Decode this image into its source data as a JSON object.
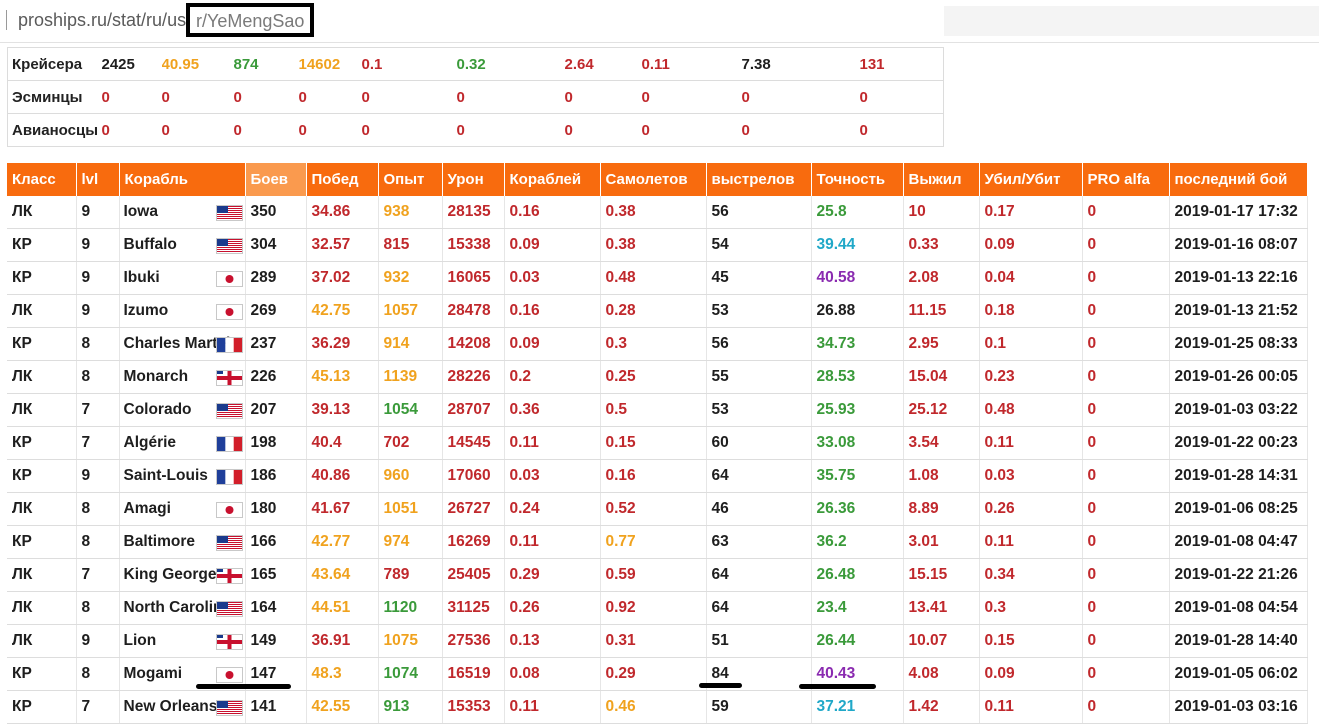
{
  "url": {
    "prefix": "proships.ru/stat/ru/us",
    "boxed": "r/YeMengSao"
  },
  "colors": {
    "header_bg": "#f86b0e",
    "header_sorted_bg": "#fa9a4e",
    "black": "#1e1e1e",
    "red": "#c0282c",
    "orange": "#f0a21e",
    "green": "#3a9a3a",
    "teal": "#20a8c8",
    "purple": "#8a2ab0"
  },
  "summary": {
    "rows": [
      {
        "label": "Крейсера",
        "cells": [
          {
            "v": "2425",
            "c": "black"
          },
          {
            "v": "40.95",
            "c": "orange"
          },
          {
            "v": "874",
            "c": "green"
          },
          {
            "v": "14602",
            "c": "orange"
          },
          {
            "v": "0.1",
            "c": "red"
          },
          {
            "v": "0.32",
            "c": "green"
          },
          {
            "v": "2.64",
            "c": "red"
          },
          {
            "v": "0.11",
            "c": "red"
          },
          {
            "v": "7.38",
            "c": "black"
          },
          {
            "v": "131",
            "c": "red"
          }
        ]
      },
      {
        "label": "Эсминцы",
        "cells": [
          {
            "v": "0",
            "c": "red"
          },
          {
            "v": "0",
            "c": "red"
          },
          {
            "v": "0",
            "c": "red"
          },
          {
            "v": "0",
            "c": "red"
          },
          {
            "v": "0",
            "c": "red"
          },
          {
            "v": "0",
            "c": "red"
          },
          {
            "v": "0",
            "c": "red"
          },
          {
            "v": "0",
            "c": "red"
          },
          {
            "v": "0",
            "c": "red"
          },
          {
            "v": "0",
            "c": "red"
          }
        ]
      },
      {
        "label": "Авианосцы",
        "cells": [
          {
            "v": "0",
            "c": "red"
          },
          {
            "v": "0",
            "c": "red"
          },
          {
            "v": "0",
            "c": "red"
          },
          {
            "v": "0",
            "c": "red"
          },
          {
            "v": "0",
            "c": "red"
          },
          {
            "v": "0",
            "c": "red"
          },
          {
            "v": "0",
            "c": "red"
          },
          {
            "v": "0",
            "c": "red"
          },
          {
            "v": "0",
            "c": "red"
          },
          {
            "v": "0",
            "c": "red"
          }
        ]
      }
    ]
  },
  "table": {
    "headers": [
      "Класс",
      "lvl",
      "Корабль",
      "Боев",
      "Побед",
      "Опыт",
      "Урон",
      "Кораблей",
      "Самолетов",
      "выстрелов",
      "Точность",
      "Выжил",
      "Убил/Убит",
      "PRO alfa",
      "последний бой"
    ],
    "sorted_column": "Боев",
    "rows": [
      {
        "cls": "ЛК",
        "lvl": "9",
        "ship": "Iowa",
        "flag": "us",
        "battles": "350",
        "wins": "34.86",
        "wins_c": "red",
        "xp": "938",
        "xp_c": "orange",
        "dmg": "28135",
        "kills": "0.16",
        "planes": "0.38",
        "planes_c": "red",
        "shots": "56",
        "acc": "25.8",
        "acc_c": "green",
        "surv": "10",
        "kd": "0.17",
        "pro": "0",
        "last": "2019-01-17 17:32"
      },
      {
        "cls": "КР",
        "lvl": "9",
        "ship": "Buffalo",
        "flag": "us",
        "battles": "304",
        "wins": "32.57",
        "wins_c": "red",
        "xp": "815",
        "xp_c": "red",
        "dmg": "15338",
        "kills": "0.09",
        "planes": "0.38",
        "planes_c": "red",
        "shots": "54",
        "acc": "39.44",
        "acc_c": "teal",
        "surv": "0.33",
        "kd": "0.09",
        "pro": "0",
        "last": "2019-01-16 08:07"
      },
      {
        "cls": "КР",
        "lvl": "9",
        "ship": "Ibuki",
        "flag": "jp",
        "battles": "289",
        "wins": "37.02",
        "wins_c": "red",
        "xp": "932",
        "xp_c": "orange",
        "dmg": "16065",
        "kills": "0.03",
        "planes": "0.48",
        "planes_c": "red",
        "shots": "45",
        "acc": "40.58",
        "acc_c": "purple",
        "surv": "2.08",
        "kd": "0.04",
        "pro": "0",
        "last": "2019-01-13 22:16"
      },
      {
        "cls": "ЛК",
        "lvl": "9",
        "ship": "Izumo",
        "flag": "jp",
        "battles": "269",
        "wins": "42.75",
        "wins_c": "orange",
        "xp": "1057",
        "xp_c": "orange",
        "dmg": "28478",
        "kills": "0.16",
        "planes": "0.28",
        "planes_c": "red",
        "shots": "53",
        "acc": "26.88",
        "acc_c": "black",
        "surv": "11.15",
        "kd": "0.18",
        "pro": "0",
        "last": "2019-01-13 21:52"
      },
      {
        "cls": "КР",
        "lvl": "8",
        "ship": "Charles Martel",
        "flag": "fr",
        "battles": "237",
        "wins": "36.29",
        "wins_c": "red",
        "xp": "914",
        "xp_c": "orange",
        "dmg": "14208",
        "kills": "0.09",
        "planes": "0.3",
        "planes_c": "red",
        "shots": "56",
        "acc": "34.73",
        "acc_c": "green",
        "surv": "2.95",
        "kd": "0.1",
        "pro": "0",
        "last": "2019-01-25 08:33"
      },
      {
        "cls": "ЛК",
        "lvl": "8",
        "ship": "Monarch",
        "flag": "uk",
        "battles": "226",
        "wins": "45.13",
        "wins_c": "orange",
        "xp": "1139",
        "xp_c": "orange",
        "dmg": "28226",
        "kills": "0.2",
        "planes": "0.25",
        "planes_c": "red",
        "shots": "55",
        "acc": "28.53",
        "acc_c": "green",
        "surv": "15.04",
        "kd": "0.23",
        "pro": "0",
        "last": "2019-01-26 00:05"
      },
      {
        "cls": "ЛК",
        "lvl": "7",
        "ship": "Colorado",
        "flag": "us",
        "battles": "207",
        "wins": "39.13",
        "wins_c": "red",
        "xp": "1054",
        "xp_c": "green",
        "dmg": "28707",
        "kills": "0.36",
        "planes": "0.5",
        "planes_c": "red",
        "shots": "53",
        "acc": "25.93",
        "acc_c": "green",
        "surv": "25.12",
        "kd": "0.48",
        "pro": "0",
        "last": "2019-01-03 03:22"
      },
      {
        "cls": "КР",
        "lvl": "7",
        "ship": "Algérie",
        "flag": "fr",
        "battles": "198",
        "wins": "40.4",
        "wins_c": "red",
        "xp": "702",
        "xp_c": "red",
        "dmg": "14545",
        "kills": "0.11",
        "planes": "0.15",
        "planes_c": "red",
        "shots": "60",
        "acc": "33.08",
        "acc_c": "green",
        "surv": "3.54",
        "kd": "0.11",
        "pro": "0",
        "last": "2019-01-22 00:23"
      },
      {
        "cls": "КР",
        "lvl": "9",
        "ship": "Saint-Louis",
        "flag": "fr",
        "battles": "186",
        "wins": "40.86",
        "wins_c": "red",
        "xp": "960",
        "xp_c": "orange",
        "dmg": "17060",
        "kills": "0.03",
        "planes": "0.16",
        "planes_c": "red",
        "shots": "64",
        "acc": "35.75",
        "acc_c": "green",
        "surv": "1.08",
        "kd": "0.03",
        "pro": "0",
        "last": "2019-01-28 14:31"
      },
      {
        "cls": "ЛК",
        "lvl": "8",
        "ship": "Amagi",
        "flag": "jp",
        "battles": "180",
        "wins": "41.67",
        "wins_c": "red",
        "xp": "1051",
        "xp_c": "orange",
        "dmg": "26727",
        "kills": "0.24",
        "planes": "0.52",
        "planes_c": "red",
        "shots": "46",
        "acc": "26.36",
        "acc_c": "green",
        "surv": "8.89",
        "kd": "0.26",
        "pro": "0",
        "last": "2019-01-06 08:25"
      },
      {
        "cls": "КР",
        "lvl": "8",
        "ship": "Baltimore",
        "flag": "us",
        "battles": "166",
        "wins": "42.77",
        "wins_c": "orange",
        "xp": "974",
        "xp_c": "orange",
        "dmg": "16269",
        "kills": "0.11",
        "planes": "0.77",
        "planes_c": "orange",
        "shots": "63",
        "acc": "36.2",
        "acc_c": "green",
        "surv": "3.01",
        "kd": "0.11",
        "pro": "0",
        "last": "2019-01-08 04:47"
      },
      {
        "cls": "ЛК",
        "lvl": "7",
        "ship": "King George V",
        "flag": "uk",
        "battles": "165",
        "wins": "43.64",
        "wins_c": "orange",
        "xp": "789",
        "xp_c": "red",
        "dmg": "25405",
        "kills": "0.29",
        "planes": "0.59",
        "planes_c": "red",
        "shots": "64",
        "acc": "26.48",
        "acc_c": "green",
        "surv": "15.15",
        "kd": "0.34",
        "pro": "0",
        "last": "2019-01-22 21:26"
      },
      {
        "cls": "ЛК",
        "lvl": "8",
        "ship": "North Carolina",
        "flag": "us",
        "battles": "164",
        "wins": "44.51",
        "wins_c": "orange",
        "xp": "1120",
        "xp_c": "green",
        "dmg": "31125",
        "kills": "0.26",
        "planes": "0.92",
        "planes_c": "red",
        "shots": "64",
        "acc": "23.4",
        "acc_c": "green",
        "surv": "13.41",
        "kd": "0.3",
        "pro": "0",
        "last": "2019-01-08 04:54"
      },
      {
        "cls": "ЛК",
        "lvl": "9",
        "ship": "Lion",
        "flag": "uk",
        "battles": "149",
        "wins": "36.91",
        "wins_c": "red",
        "xp": "1075",
        "xp_c": "orange",
        "dmg": "27536",
        "kills": "0.13",
        "planes": "0.31",
        "planes_c": "red",
        "shots": "51",
        "acc": "26.44",
        "acc_c": "green",
        "surv": "10.07",
        "kd": "0.15",
        "pro": "0",
        "last": "2019-01-28 14:40"
      },
      {
        "cls": "КР",
        "lvl": "8",
        "ship": "Mogami",
        "flag": "jp",
        "battles": "147",
        "wins": "48.3",
        "wins_c": "orange",
        "xp": "1074",
        "xp_c": "green",
        "dmg": "16519",
        "kills": "0.08",
        "planes": "0.29",
        "planes_c": "red",
        "shots": "84",
        "acc": "40.43",
        "acc_c": "purple",
        "surv": "4.08",
        "kd": "0.09",
        "pro": "0",
        "last": "2019-01-05 06:02"
      },
      {
        "cls": "КР",
        "lvl": "7",
        "ship": "New Orleans",
        "flag": "us",
        "battles": "141",
        "wins": "42.55",
        "wins_c": "orange",
        "xp": "913",
        "xp_c": "green",
        "dmg": "15353",
        "kills": "0.11",
        "planes": "0.46",
        "planes_c": "orange",
        "shots": "59",
        "acc": "37.21",
        "acc_c": "teal",
        "surv": "1.42",
        "kd": "0.11",
        "pro": "0",
        "last": "2019-01-03 03:16"
      }
    ]
  }
}
